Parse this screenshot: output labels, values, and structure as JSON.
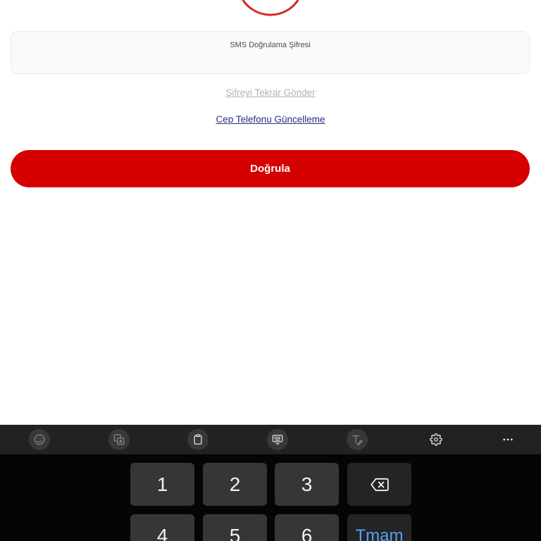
{
  "verification": {
    "field_label": "SMS Doğrulama Şifresi",
    "field_value": "",
    "resend_link": "Şifreyi Tekrar Gönder",
    "update_phone_link": "Cep Telefonu Güncelleme",
    "verify_button": "Doğrula"
  },
  "keyboard": {
    "toolbar_icons": [
      "emoji-icon",
      "translate-icon",
      "clipboard-icon",
      "keyboard-mode-icon",
      "handwriting-icon",
      "settings-icon",
      "more-options-icon"
    ],
    "row1": [
      "1",
      "2",
      "3"
    ],
    "row1_action_icon": "backspace-icon",
    "row2": [
      "4",
      "5",
      "6"
    ],
    "row2_action": "Tmam"
  },
  "colors": {
    "brand_red": "#d50000",
    "link_disabled": "#b3b3b3",
    "link_active": "#2b2d80",
    "keyboard_accent": "#5b9ef6"
  }
}
